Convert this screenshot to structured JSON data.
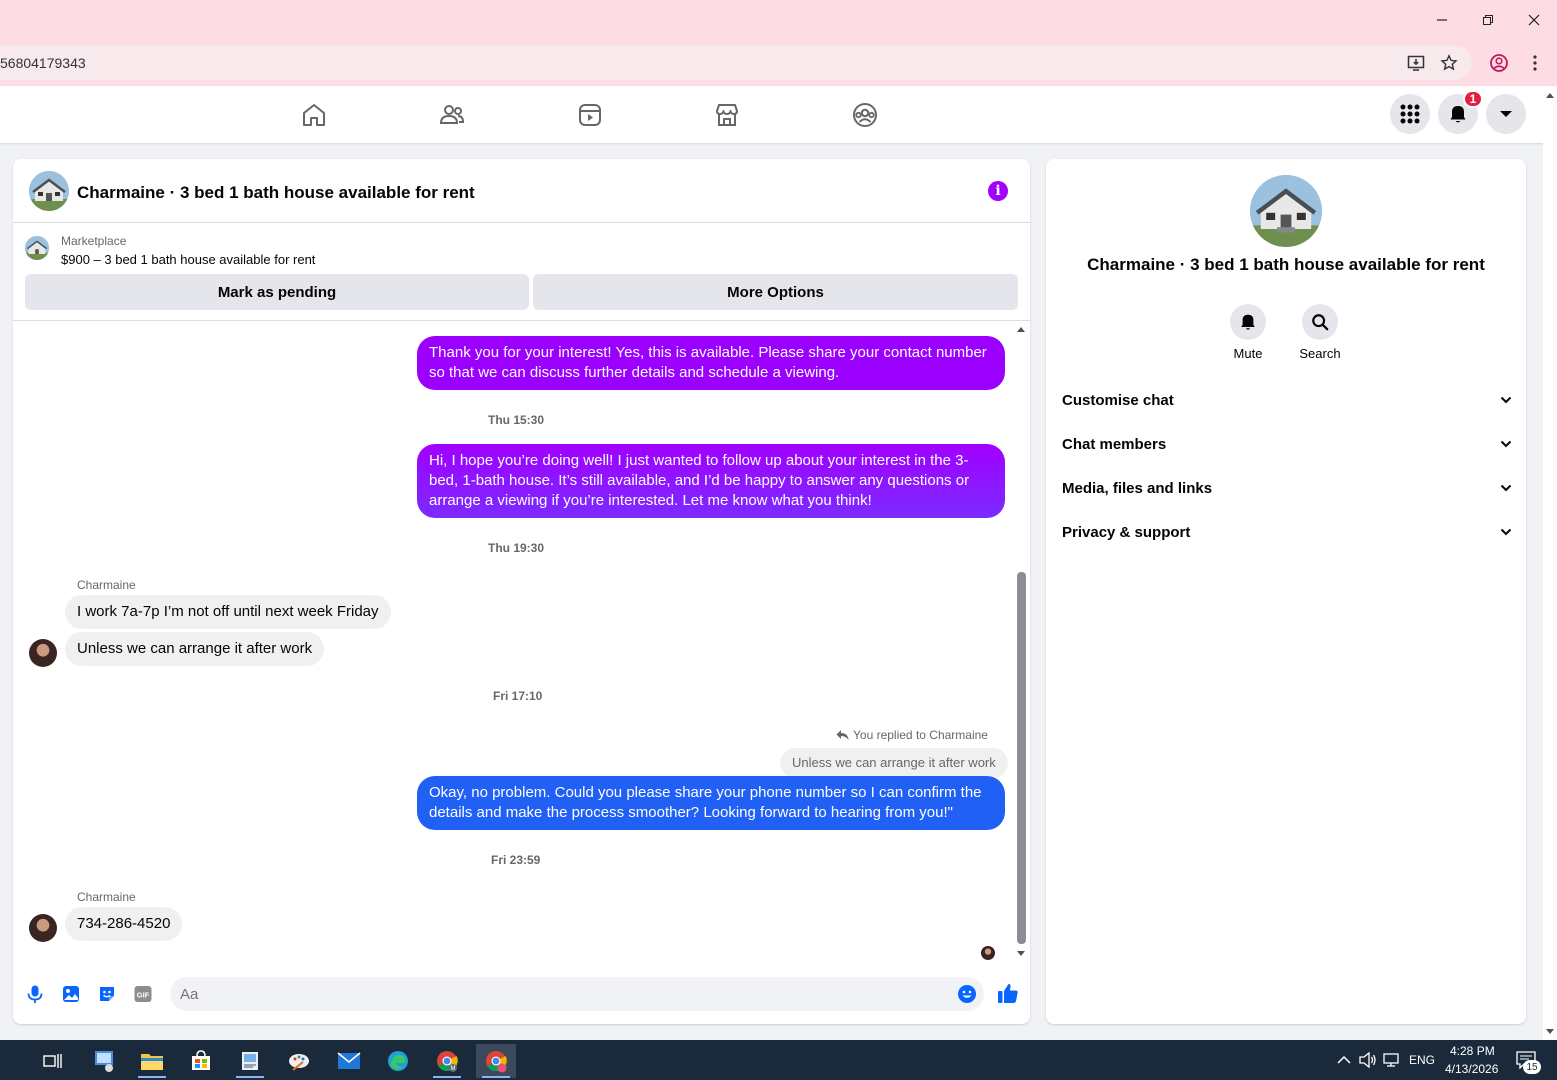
{
  "browser": {
    "url": "56804179343",
    "window_controls": [
      "minimize",
      "restore",
      "close"
    ]
  },
  "nav": {
    "icons": [
      "home-icon",
      "friends-icon",
      "watch-icon",
      "marketplace-icon",
      "groups-icon"
    ],
    "notification_count": "1"
  },
  "chat": {
    "title": "Charmaine · 3 bed 1 bath house available for rent",
    "marketplace_label": "Marketplace",
    "listing": "$900 – 3 bed 1 bath house available for rent",
    "mark_pending": "Mark as pending",
    "more_options": "More Options",
    "messages": {
      "m1": "Thank you for your interest! Yes, this is available. Please share your contact number so that we can discuss further details and schedule a viewing.",
      "t1": "Thu 15:30",
      "m2": "Hi, I hope you’re doing well! I just wanted to follow up about your interest in the 3-bed, 1-bath house. It’s still available, and I’d be happy to answer any questions or arrange a viewing if you’re interested. Let me know what you think!",
      "t2": "Thu 19:30",
      "sender1": "Charmaine",
      "m3": "I work 7a-7p I’m not off until next week Friday",
      "m4": "Unless we can arrange it after work",
      "t3": "Fri 17:10",
      "reply_label": "You replied to Charmaine",
      "reply_quote": "Unless we can arrange it after work",
      "m5": "Okay, no problem. Could you please share your phone number so I can confirm the details and make the process smoother? Looking forward to hearing from you!\"",
      "t4": "Fri 23:59",
      "sender2": "Charmaine",
      "m6": "734-286-4520"
    },
    "composer_placeholder": "Aa"
  },
  "side": {
    "title": "Charmaine · 3 bed 1 bath house available for rent",
    "mute": "Mute",
    "search": "Search",
    "sections": [
      "Customise chat",
      "Chat members",
      "Media, files and links",
      "Privacy & support"
    ]
  },
  "taskbar": {
    "lang": "ENG",
    "time": "4:28 PM",
    "date": "4/13/2026",
    "notif_count": "15"
  },
  "colors": {
    "accent_purple": "#a100ff",
    "bubble_gradient_top": "#9b00ff",
    "bubble_gradient_blue": "#1a5cff",
    "fb_blue": "#0866ff"
  }
}
